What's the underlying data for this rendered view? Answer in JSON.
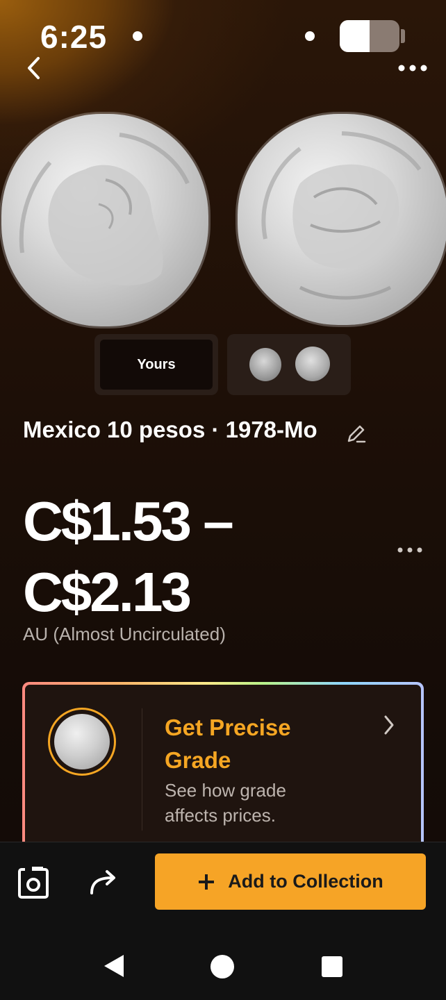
{
  "status_bar": {
    "time": "6:25",
    "battery_level": 0.5
  },
  "header": {
    "back_icon": "chevron-left-icon",
    "more_icon": "more-horizontal-icon"
  },
  "thumbnails": {
    "yours_label": "Yours"
  },
  "coin": {
    "title": "Mexico 10 pesos · 1978-Mo",
    "edit_icon": "pencil-icon"
  },
  "price": {
    "range": "C$1.53 – C$2.13",
    "grade": "AU (Almost Uncirculated)"
  },
  "grade_card": {
    "title": "Get Precise Grade",
    "subtitle": "See how grade affects prices.",
    "chevron_icon": "chevron-right-icon"
  },
  "bottom_bar": {
    "camera_icon": "camera-icon",
    "share_icon": "share-icon",
    "add_label": "Add to Collection"
  },
  "colors": {
    "accent": "#f6a426",
    "background": "#130b07",
    "card_background": "#1f140f"
  }
}
